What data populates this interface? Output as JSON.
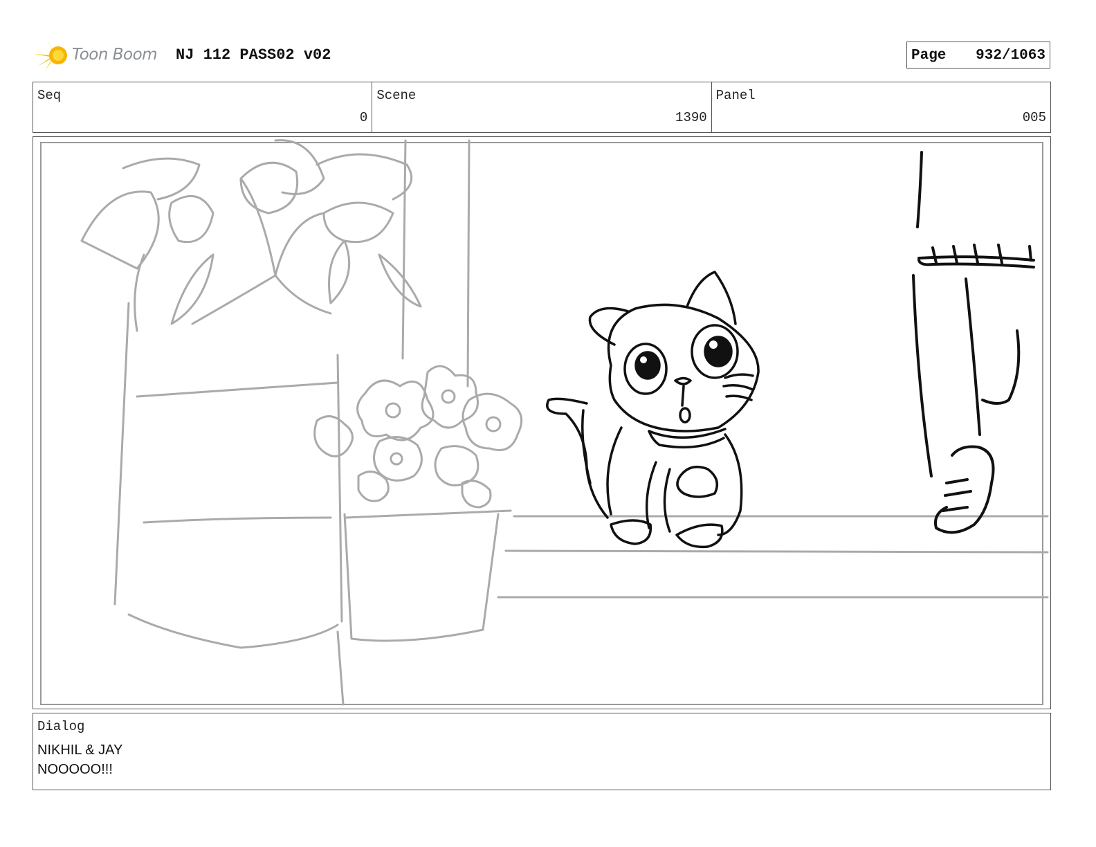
{
  "header": {
    "logo_text": "Toon Boom",
    "logo_icon": "sun-burst-icon",
    "project_title": "NJ 112 PASS02 v02",
    "page_label": "Page",
    "page_value": "932/1063"
  },
  "info": {
    "seq_label": "Seq",
    "seq_value": "0",
    "scene_label": "Scene",
    "scene_value": "1390",
    "panel_label": "Panel",
    "panel_value": "005"
  },
  "dialog": {
    "label": "Dialog",
    "speaker": "NIKHIL & JAY",
    "line": "NOOOOO!!!"
  }
}
